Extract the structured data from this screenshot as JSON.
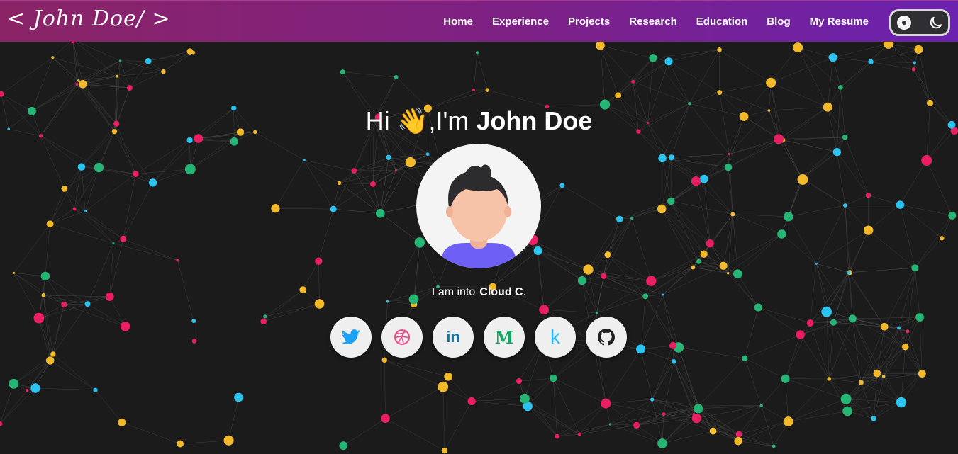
{
  "header": {
    "logo": "< John Doe/ >",
    "nav": [
      {
        "label": "Home"
      },
      {
        "label": "Experience"
      },
      {
        "label": "Projects"
      },
      {
        "label": "Research"
      },
      {
        "label": "Education"
      },
      {
        "label": "Blog"
      },
      {
        "label": "My Resume"
      }
    ],
    "theme_toggle": {
      "state": "dark",
      "icon": "moon-icon"
    }
  },
  "hero": {
    "greeting_hi": "Hi",
    "greeting_emoji": "👋",
    "greeting_im": ",I'm",
    "greeting_name": "John Doe",
    "tagline_prefix": "I am into",
    "tagline_typed": "Cloud C",
    "tagline_suffix": "."
  },
  "socials": [
    {
      "name": "twitter",
      "icon": "twitter-icon",
      "color": "#1da1f2"
    },
    {
      "name": "dribbble",
      "icon": "dribbble-icon",
      "color": "#ea4c89"
    },
    {
      "name": "linkedin",
      "icon": "linkedin-icon",
      "glyph": "in",
      "color": "#0e76a8"
    },
    {
      "name": "medium",
      "icon": "medium-icon",
      "glyph": "M",
      "color": "#12a660"
    },
    {
      "name": "kaggle",
      "icon": "kaggle-icon",
      "glyph": "k",
      "color": "#20beff"
    },
    {
      "name": "github",
      "icon": "github-icon",
      "color": "#222222"
    }
  ],
  "colors": {
    "background": "#1b1b1c",
    "nav_gradient_start": "#8b2466",
    "nav_gradient_end": "#6b22b0",
    "particle_colors": [
      "#e91e63",
      "#2bc4f0",
      "#f2b92b",
      "#25b574"
    ],
    "avatar_shirt": "#6e5ff5",
    "avatar_skin": "#f6c3a8",
    "avatar_hair": "#2c2c2e"
  }
}
